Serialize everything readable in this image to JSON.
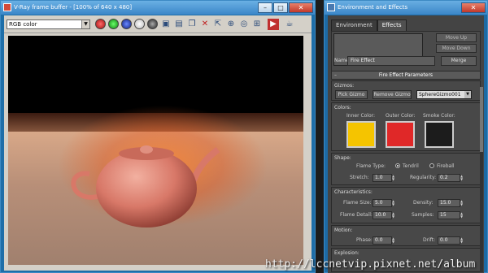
{
  "vfb": {
    "title": "V-Ray frame buffer - [100% of 640 x 480]",
    "channel": "RGB color",
    "toolbar_icons": [
      "red-channel-icon",
      "green-channel-icon",
      "blue-channel-icon",
      "alpha-icon",
      "mono-icon",
      "save-icon",
      "load-icon",
      "copy-icon",
      "clear-icon",
      "track-mouse-icon",
      "zoom-icon",
      "lens-icon",
      "pixel-info-icon",
      "render-icon",
      "teapot-icon"
    ]
  },
  "env": {
    "title": "Environment and Effects",
    "tabs": [
      "Environment",
      "Effects"
    ],
    "move_up": "Move Up",
    "move_down": "Move Down",
    "name_label": "Name:",
    "name_value": "Fire Effect",
    "merge": "Merge",
    "params_header": "Fire Effect Parameters",
    "gizmos": {
      "label": "Gizmos:",
      "pick": "Pick Gizmo",
      "remove": "Remove Gizmo",
      "selected": "SphereGizmo001"
    },
    "colors": {
      "label": "Colors:",
      "inner_label": "Inner Color:",
      "outer_label": "Outer Color:",
      "smoke_label": "Smoke Color:",
      "inner": "#f5c400",
      "outer": "#e02828",
      "smoke": "#1c1c1c"
    },
    "shape": {
      "label": "Shape:",
      "flame_type_label": "Flame Type:",
      "tendril": "Tendril",
      "fireball": "Fireball",
      "stretch_label": "Stretch:",
      "stretch": "1.0",
      "regularity_label": "Regularity:",
      "regularity": "0.2"
    },
    "characteristics": {
      "label": "Characteristics:",
      "flame_size_label": "Flame Size:",
      "flame_size": "5.0",
      "density_label": "Density:",
      "density": "15.0",
      "flame_detail_label": "Flame Detail:",
      "flame_detail": "10.0",
      "samples_label": "Samples:",
      "samples": "15"
    },
    "motion": {
      "label": "Motion:",
      "phase_label": "Phase:",
      "phase": "0.0",
      "drift_label": "Drift:",
      "drift": "0.0"
    },
    "explosion_label": "Explosion:"
  },
  "watermark": "http://lccnetvip.pixnet.net/album"
}
